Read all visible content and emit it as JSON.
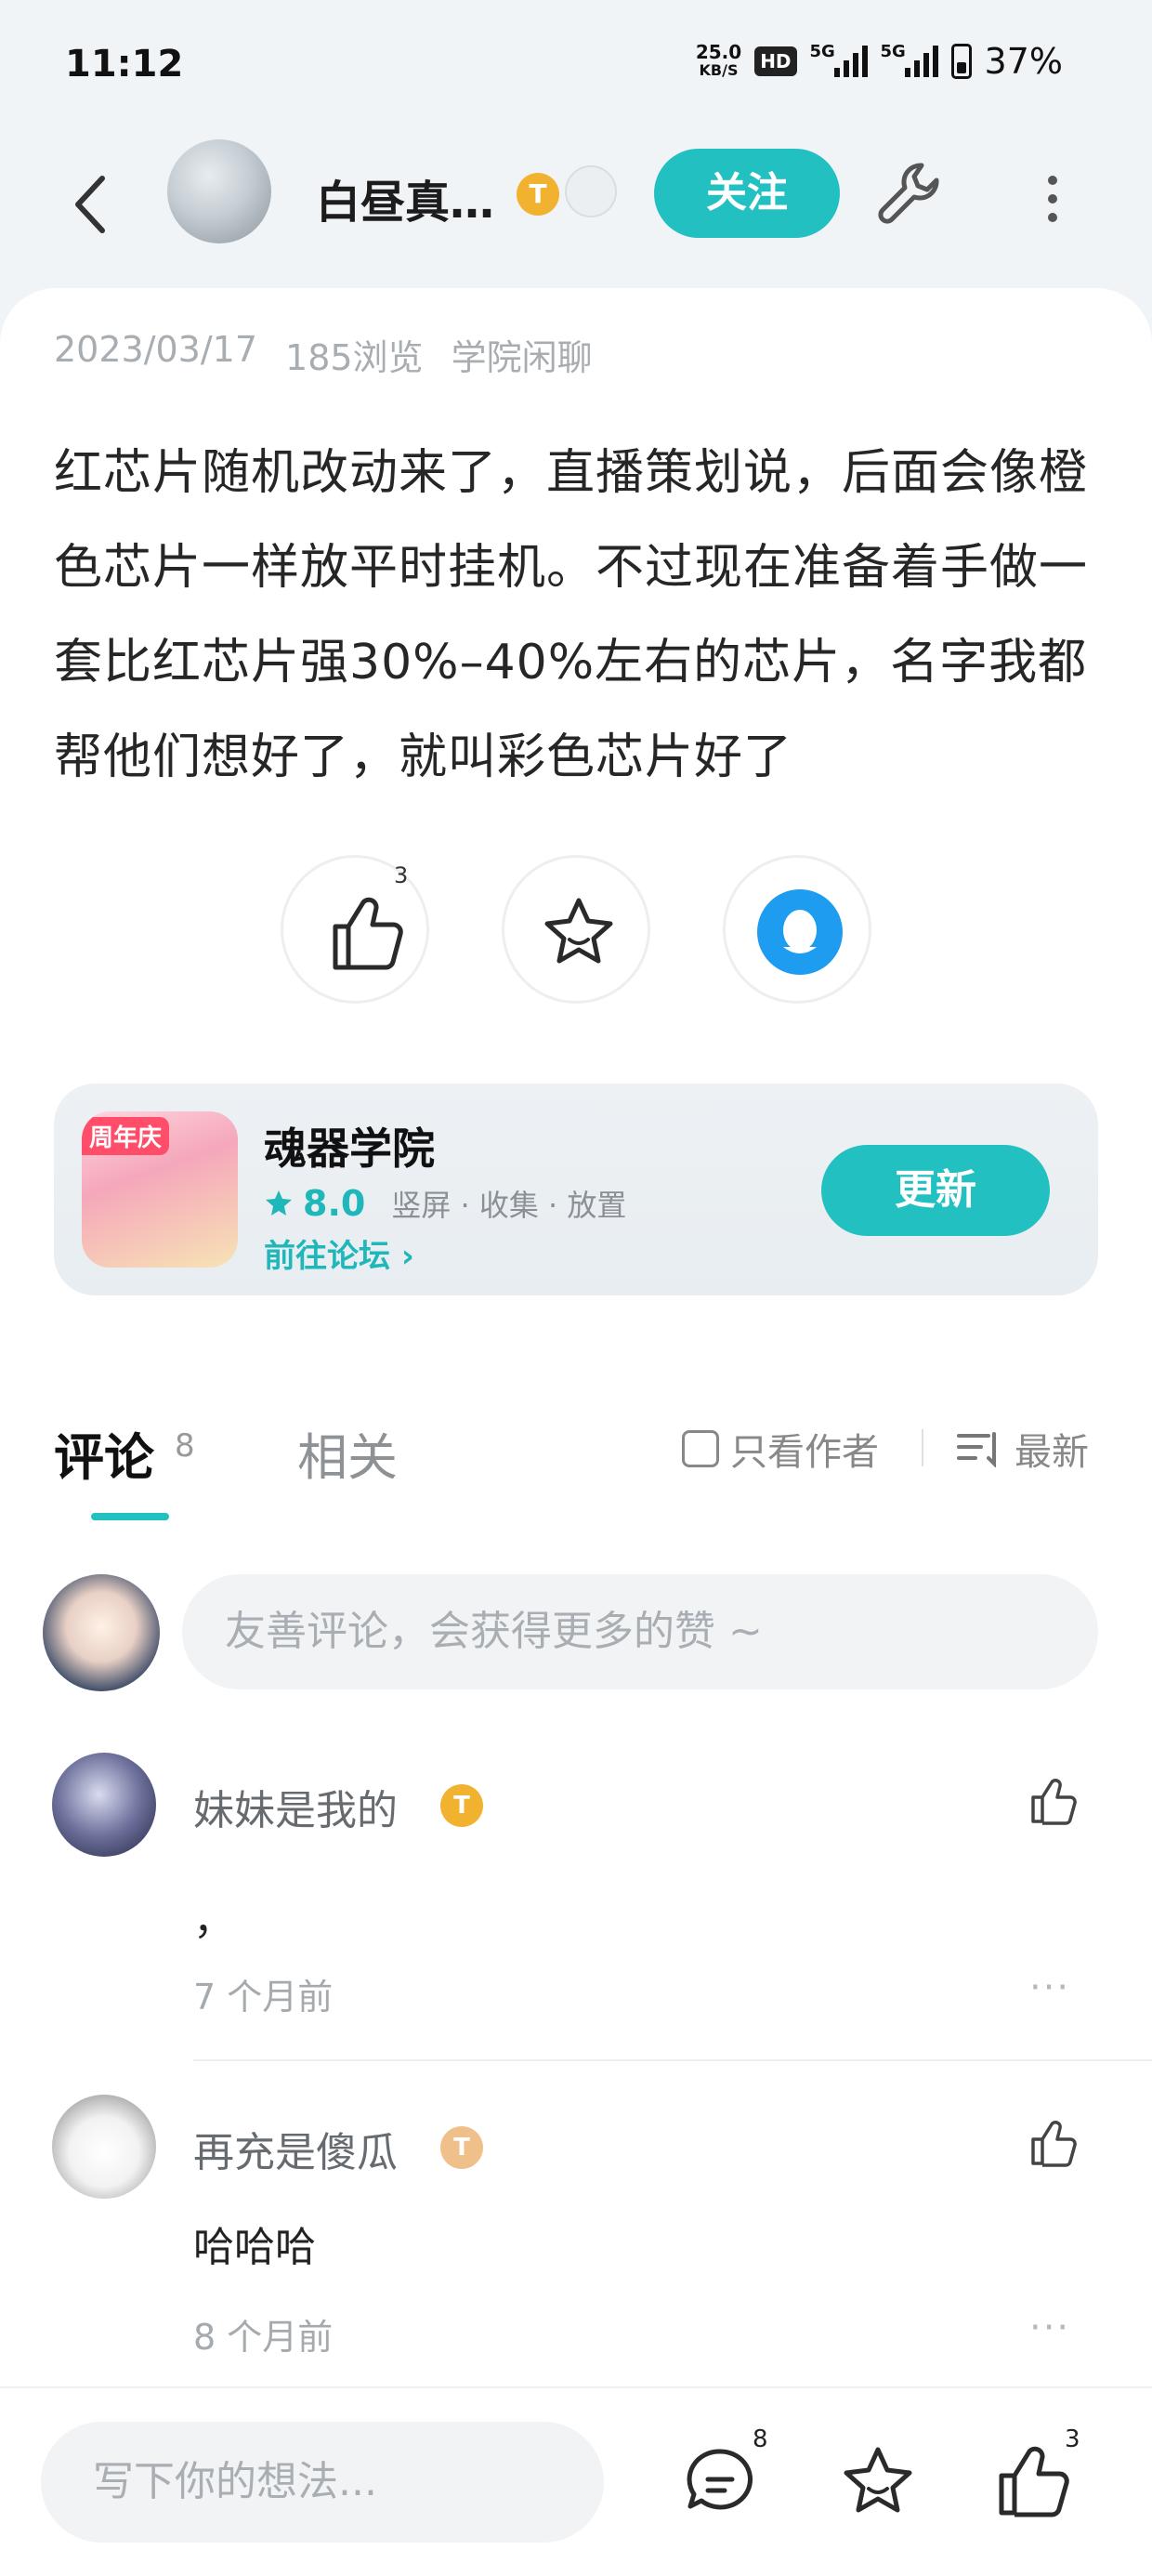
{
  "status": {
    "time": "11:12",
    "net_speed_value": "25.0",
    "net_speed_unit": "KB/S",
    "hd_label": "HD",
    "sim1_tag": "5G",
    "sim2_tag": "5G",
    "battery": "37%"
  },
  "header": {
    "author_name": "白昼真…",
    "level_badge": "T",
    "follow_label": "关注"
  },
  "post": {
    "date": "2023/03/17",
    "views": "185浏览",
    "category": "学院闲聊",
    "body": "红芯片随机改动来了，直播策划说，后面会像橙色芯片一样放平时挂机。不过现在准备着手做一套比红芯片强30%–40%左右的芯片，名字我都帮他们想好了，就叫彩色芯片好了",
    "like_count": "3"
  },
  "game": {
    "ribbon": "周年庆",
    "title": "魂器学院",
    "rating": "8.0",
    "tags": "竖屏 · 收集 · 放置",
    "forum_link": "前往论坛",
    "update_label": "更新"
  },
  "comments_section": {
    "tab_comments": "评论",
    "tab_comments_count": "8",
    "tab_related": "相关",
    "author_only": "只看作者",
    "sort_label": "最新",
    "input_placeholder": "友善评论，会获得更多的赞 ~",
    "items": [
      {
        "name": "妹妹是我的",
        "badge": "T",
        "text": "，",
        "time": "7 个月前",
        "badge_color": "#f1b230"
      },
      {
        "name": "再充是傻瓜",
        "badge": "T",
        "text": "哈哈哈",
        "time": "8 个月前",
        "badge_color": "#f0c08a"
      }
    ],
    "more_glyph": "···"
  },
  "bottom": {
    "input_placeholder": "写下你的想法...",
    "comment_count": "8",
    "like_count": "3"
  },
  "colors": {
    "accent": "#23c0c2",
    "gold": "#f1b230"
  }
}
